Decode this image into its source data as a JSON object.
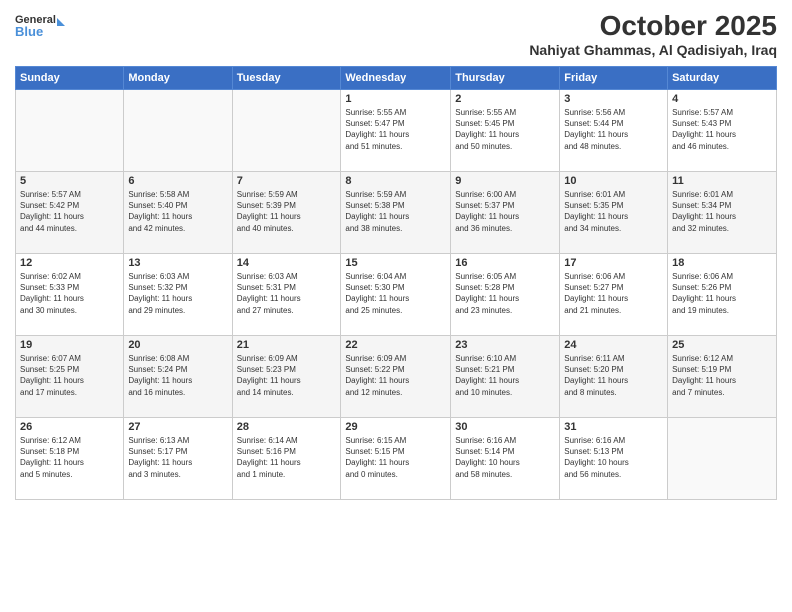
{
  "header": {
    "logo_line1": "General",
    "logo_line2": "Blue",
    "month": "October 2025",
    "location": "Nahiyat Ghammas, Al Qadisiyah, Iraq"
  },
  "weekdays": [
    "Sunday",
    "Monday",
    "Tuesday",
    "Wednesday",
    "Thursday",
    "Friday",
    "Saturday"
  ],
  "weeks": [
    [
      {
        "day": "",
        "info": ""
      },
      {
        "day": "",
        "info": ""
      },
      {
        "day": "",
        "info": ""
      },
      {
        "day": "1",
        "info": "Sunrise: 5:55 AM\nSunset: 5:47 PM\nDaylight: 11 hours\nand 51 minutes."
      },
      {
        "day": "2",
        "info": "Sunrise: 5:55 AM\nSunset: 5:45 PM\nDaylight: 11 hours\nand 50 minutes."
      },
      {
        "day": "3",
        "info": "Sunrise: 5:56 AM\nSunset: 5:44 PM\nDaylight: 11 hours\nand 48 minutes."
      },
      {
        "day": "4",
        "info": "Sunrise: 5:57 AM\nSunset: 5:43 PM\nDaylight: 11 hours\nand 46 minutes."
      }
    ],
    [
      {
        "day": "5",
        "info": "Sunrise: 5:57 AM\nSunset: 5:42 PM\nDaylight: 11 hours\nand 44 minutes."
      },
      {
        "day": "6",
        "info": "Sunrise: 5:58 AM\nSunset: 5:40 PM\nDaylight: 11 hours\nand 42 minutes."
      },
      {
        "day": "7",
        "info": "Sunrise: 5:59 AM\nSunset: 5:39 PM\nDaylight: 11 hours\nand 40 minutes."
      },
      {
        "day": "8",
        "info": "Sunrise: 5:59 AM\nSunset: 5:38 PM\nDaylight: 11 hours\nand 38 minutes."
      },
      {
        "day": "9",
        "info": "Sunrise: 6:00 AM\nSunset: 5:37 PM\nDaylight: 11 hours\nand 36 minutes."
      },
      {
        "day": "10",
        "info": "Sunrise: 6:01 AM\nSunset: 5:35 PM\nDaylight: 11 hours\nand 34 minutes."
      },
      {
        "day": "11",
        "info": "Sunrise: 6:01 AM\nSunset: 5:34 PM\nDaylight: 11 hours\nand 32 minutes."
      }
    ],
    [
      {
        "day": "12",
        "info": "Sunrise: 6:02 AM\nSunset: 5:33 PM\nDaylight: 11 hours\nand 30 minutes."
      },
      {
        "day": "13",
        "info": "Sunrise: 6:03 AM\nSunset: 5:32 PM\nDaylight: 11 hours\nand 29 minutes."
      },
      {
        "day": "14",
        "info": "Sunrise: 6:03 AM\nSunset: 5:31 PM\nDaylight: 11 hours\nand 27 minutes."
      },
      {
        "day": "15",
        "info": "Sunrise: 6:04 AM\nSunset: 5:30 PM\nDaylight: 11 hours\nand 25 minutes."
      },
      {
        "day": "16",
        "info": "Sunrise: 6:05 AM\nSunset: 5:28 PM\nDaylight: 11 hours\nand 23 minutes."
      },
      {
        "day": "17",
        "info": "Sunrise: 6:06 AM\nSunset: 5:27 PM\nDaylight: 11 hours\nand 21 minutes."
      },
      {
        "day": "18",
        "info": "Sunrise: 6:06 AM\nSunset: 5:26 PM\nDaylight: 11 hours\nand 19 minutes."
      }
    ],
    [
      {
        "day": "19",
        "info": "Sunrise: 6:07 AM\nSunset: 5:25 PM\nDaylight: 11 hours\nand 17 minutes."
      },
      {
        "day": "20",
        "info": "Sunrise: 6:08 AM\nSunset: 5:24 PM\nDaylight: 11 hours\nand 16 minutes."
      },
      {
        "day": "21",
        "info": "Sunrise: 6:09 AM\nSunset: 5:23 PM\nDaylight: 11 hours\nand 14 minutes."
      },
      {
        "day": "22",
        "info": "Sunrise: 6:09 AM\nSunset: 5:22 PM\nDaylight: 11 hours\nand 12 minutes."
      },
      {
        "day": "23",
        "info": "Sunrise: 6:10 AM\nSunset: 5:21 PM\nDaylight: 11 hours\nand 10 minutes."
      },
      {
        "day": "24",
        "info": "Sunrise: 6:11 AM\nSunset: 5:20 PM\nDaylight: 11 hours\nand 8 minutes."
      },
      {
        "day": "25",
        "info": "Sunrise: 6:12 AM\nSunset: 5:19 PM\nDaylight: 11 hours\nand 7 minutes."
      }
    ],
    [
      {
        "day": "26",
        "info": "Sunrise: 6:12 AM\nSunset: 5:18 PM\nDaylight: 11 hours\nand 5 minutes."
      },
      {
        "day": "27",
        "info": "Sunrise: 6:13 AM\nSunset: 5:17 PM\nDaylight: 11 hours\nand 3 minutes."
      },
      {
        "day": "28",
        "info": "Sunrise: 6:14 AM\nSunset: 5:16 PM\nDaylight: 11 hours\nand 1 minute."
      },
      {
        "day": "29",
        "info": "Sunrise: 6:15 AM\nSunset: 5:15 PM\nDaylight: 11 hours\nand 0 minutes."
      },
      {
        "day": "30",
        "info": "Sunrise: 6:16 AM\nSunset: 5:14 PM\nDaylight: 10 hours\nand 58 minutes."
      },
      {
        "day": "31",
        "info": "Sunrise: 6:16 AM\nSunset: 5:13 PM\nDaylight: 10 hours\nand 56 minutes."
      },
      {
        "day": "",
        "info": ""
      }
    ]
  ]
}
